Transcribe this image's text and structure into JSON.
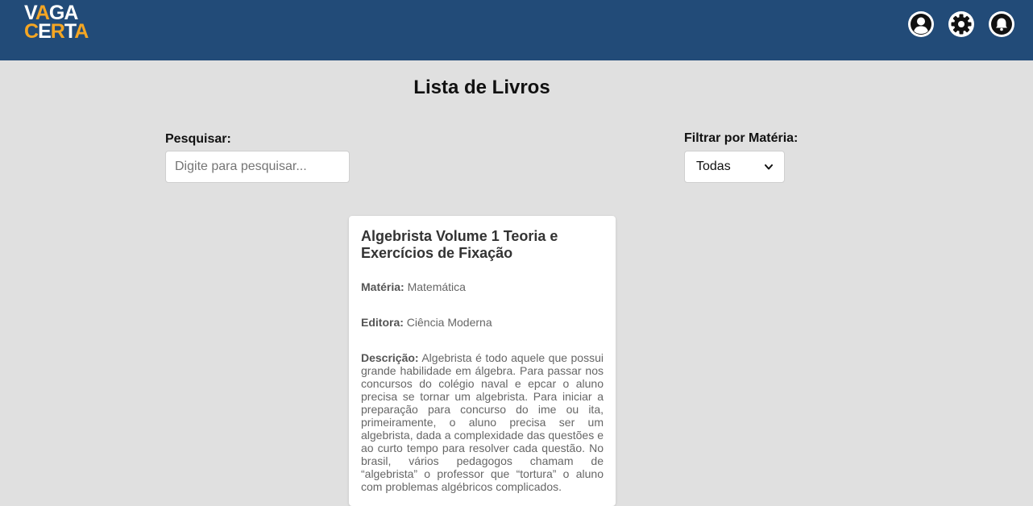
{
  "header": {
    "logo_top": "VAGA",
    "logo_bottom": "CERTA",
    "icons": [
      "user-icon",
      "gear-icon",
      "bell-icon"
    ],
    "colors": {
      "bar": "#224b78",
      "logo_accent": "#f5a623"
    }
  },
  "main": {
    "title": "Lista de Livros",
    "search": {
      "label": "Pesquisar:",
      "placeholder": "Digite para pesquisar...",
      "value": ""
    },
    "filter": {
      "label": "Filtrar por Matéria:",
      "selected": "Todas"
    }
  },
  "books": [
    {
      "title": "Algebrista Volume 1 Teoria e Exercícios de Fixação",
      "subject_label": "Matéria:",
      "subject": "Matemática",
      "publisher_label": "Editora:",
      "publisher": "Ciência Moderna",
      "description_label": "Descrição:",
      "description": "Algebrista é todo aquele que possui grande habilidade em álgebra. Para passar nos concursos do colégio naval e epcar o aluno precisa se tornar um algebrista. Para iniciar a preparação para concurso do ime ou ita, primeiramente, o aluno precisa ser um algebrista, dada a complexidade das questões e ao curto tempo para resolver cada questão. No brasil, vários pedagogos chamam de “algebrista” o professor que “tortura” o aluno com problemas algébricos complicados."
    }
  ]
}
